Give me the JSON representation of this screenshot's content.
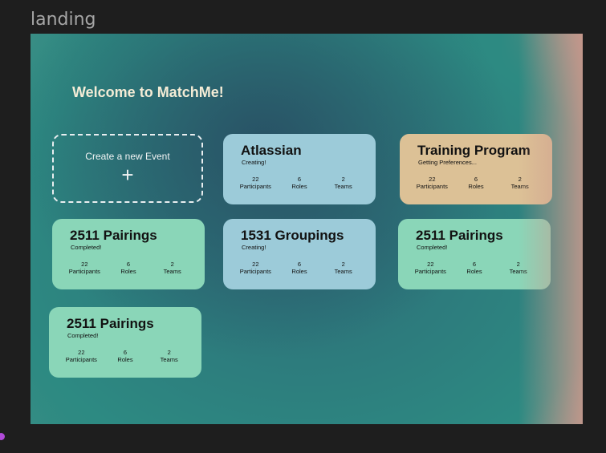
{
  "frame": {
    "label": "landing"
  },
  "header": {
    "welcome": "Welcome to MatchMe!"
  },
  "create_card": {
    "label": "Create a new Event",
    "icon": "+"
  },
  "stat_labels": {
    "participants": "Participants",
    "roles": "Roles",
    "teams": "Teams"
  },
  "events": [
    {
      "title": "Atlassian",
      "status": "Creating!",
      "participants": "22",
      "roles": "6",
      "teams": "2",
      "color": "#9ccbd9"
    },
    {
      "title": "Training Program",
      "status": "Getting Preferences...",
      "participants": "22",
      "roles": "6",
      "teams": "2",
      "color": "#dcc196"
    },
    {
      "title": "2511 Pairings",
      "status": "Completed!",
      "participants": "22",
      "roles": "6",
      "teams": "2",
      "color": "#8ad6b8"
    },
    {
      "title": "1531 Groupings",
      "status": "Creating!",
      "participants": "22",
      "roles": "6",
      "teams": "2",
      "color": "#9ccbd9"
    },
    {
      "title": "2511 Pairings",
      "status": "Completed!",
      "participants": "22",
      "roles": "6",
      "teams": "2",
      "color": "#8ad6b8"
    },
    {
      "title": "2511 Pairings",
      "status": "Completed!",
      "participants": "22",
      "roles": "6",
      "teams": "2",
      "color": "#8ad6b8"
    }
  ]
}
